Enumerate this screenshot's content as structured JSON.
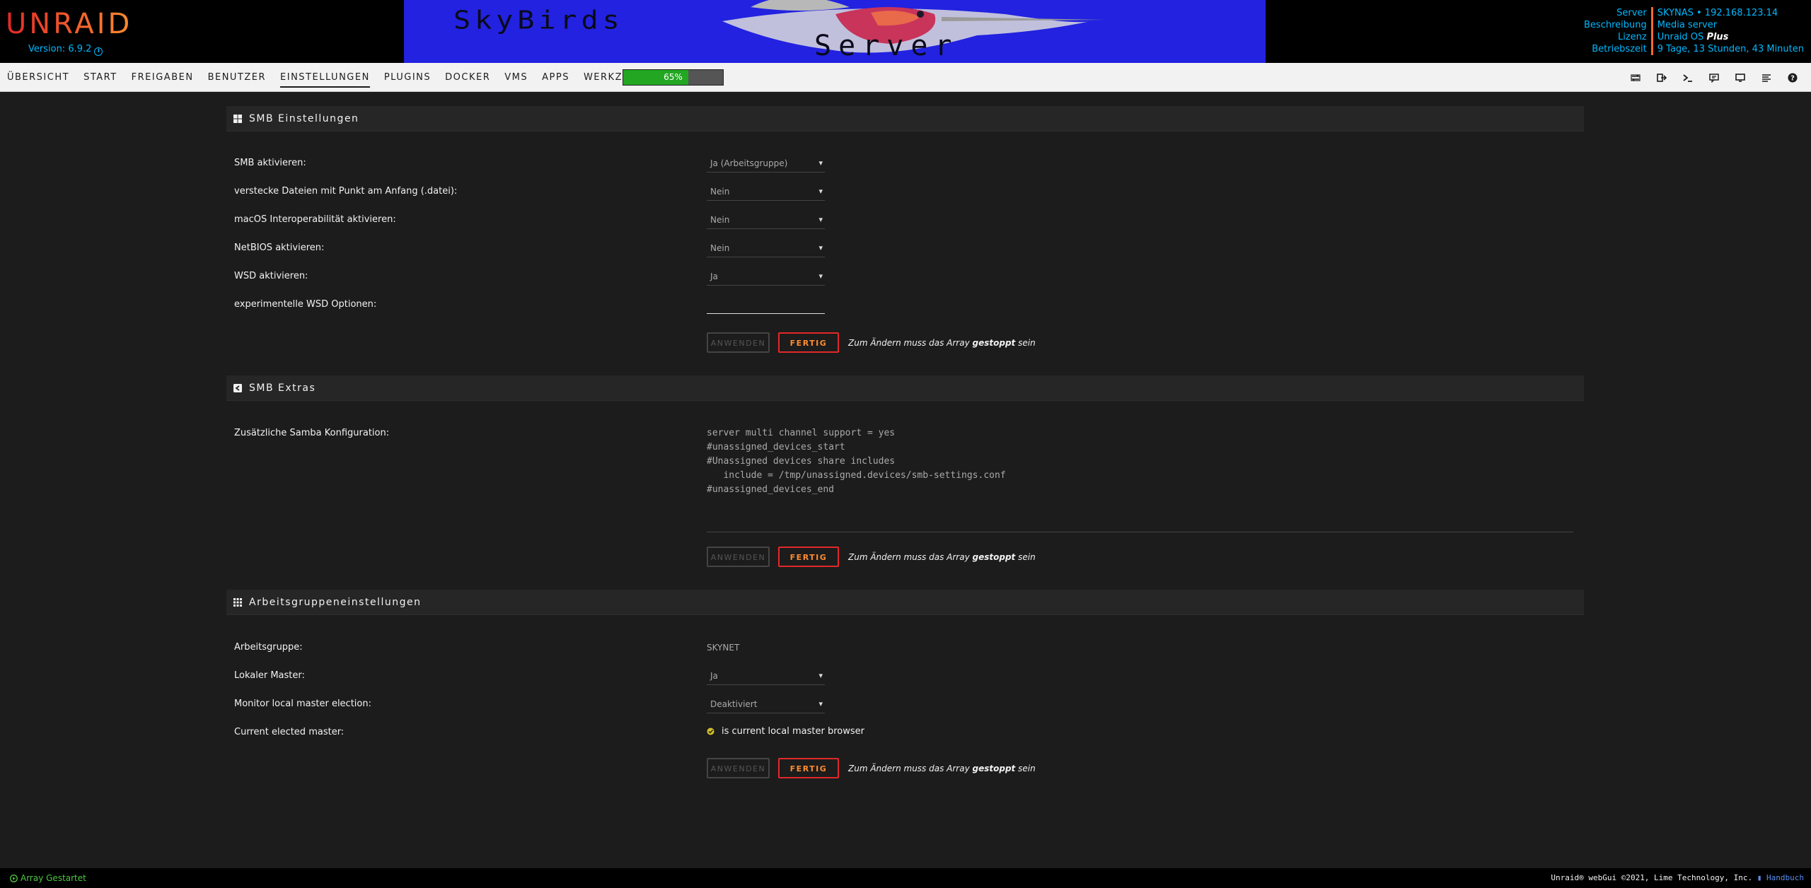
{
  "header": {
    "logo": "UNRAID",
    "version": "Version: 6.9.2",
    "banner_line1": "SkyBirds",
    "banner_line2": "Server",
    "server_info": {
      "labels": [
        "Server",
        "Beschreibung",
        "Lizenz",
        "Betriebszeit"
      ],
      "server_value": "SKYNAS • 192.168.123.14",
      "description_value": "Media server",
      "license_prefix": "Unraid OS ",
      "license_tier": "Plus",
      "uptime_value": "9 Tage, 13 Stunden, 43 Minuten"
    }
  },
  "nav": {
    "tabs": [
      "ÜBERSICHT",
      "START",
      "FREIGABEN",
      "BENUTZER",
      "EINSTELLUNGEN",
      "PLUGINS",
      "DOCKER",
      "VMS",
      "APPS",
      "WERKZEUGE"
    ],
    "active_tab": "EINSTELLUNGEN",
    "progress_label": "65%",
    "progress_value": 65
  },
  "smb": {
    "title": "SMB Einstellungen",
    "rows": [
      {
        "label": "SMB aktivieren:",
        "value": "Ja (Arbeitsgruppe)"
      },
      {
        "label": "verstecke Dateien mit Punkt am Anfang (.datei):",
        "value": "Nein"
      },
      {
        "label": "macOS Interoperabilität aktivieren:",
        "value": "Nein"
      },
      {
        "label": "NetBIOS aktivieren:",
        "value": "Nein"
      },
      {
        "label": "WSD aktivieren:",
        "value": "Ja"
      },
      {
        "label": "experimentelle WSD Optionen:",
        "value": ""
      }
    ]
  },
  "extras": {
    "title": "SMB Extras",
    "label": "Zusätzliche Samba Konfiguration:",
    "config": "server multi channel support = yes\n#unassigned_devices_start\n#Unassigned devices share includes\n   include = /tmp/unassigned.devices/smb-settings.conf\n#unassigned_devices_end"
  },
  "workgroup": {
    "title": "Arbeitsgruppeneinstellungen",
    "rows": [
      {
        "label": "Arbeitsgruppe:",
        "value": "SKYNET"
      },
      {
        "label": "Lokaler Master:",
        "value": "Ja"
      },
      {
        "label": "Monitor local master election:",
        "value": "Deaktiviert"
      },
      {
        "label": "Current elected master:",
        "value": "is current local master browser"
      }
    ]
  },
  "buttons": {
    "apply": "ANWENDEN",
    "done": "FERTIG",
    "note_prefix": "Zum Ändern muss das Array ",
    "note_bold": "gestoppt",
    "note_suffix": " sein"
  },
  "footer": {
    "status": "Array Gestartet",
    "copyright": "Unraid® webGui ©2021, Lime Technology, Inc. ",
    "manual": "Handbuch"
  },
  "colors": {
    "accent": "#ff8c2f",
    "brand_red": "#e22828",
    "link_blue": "#00b9ff",
    "ok_green": "#4bc63f"
  }
}
